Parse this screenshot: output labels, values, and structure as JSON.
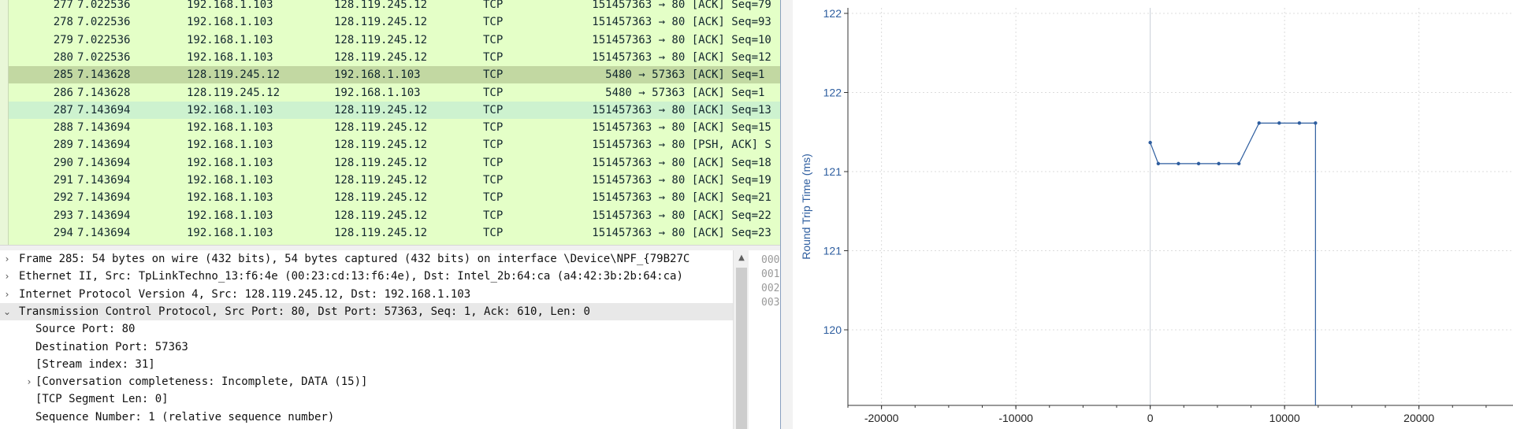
{
  "packet_list": {
    "rows": [
      {
        "no": "277",
        "time": "7.022536",
        "src": "192.168.1.103",
        "dst": "128.119.245.12",
        "proto": "TCP",
        "len": "1514",
        "info": "57363 → 80 [ACK] Seq=79",
        "state": "normal"
      },
      {
        "no": "278",
        "time": "7.022536",
        "src": "192.168.1.103",
        "dst": "128.119.245.12",
        "proto": "TCP",
        "len": "1514",
        "info": "57363 → 80 [ACK] Seq=93",
        "state": "normal"
      },
      {
        "no": "279",
        "time": "7.022536",
        "src": "192.168.1.103",
        "dst": "128.119.245.12",
        "proto": "TCP",
        "len": "1514",
        "info": "57363 → 80 [ACK] Seq=10",
        "state": "normal"
      },
      {
        "no": "280",
        "time": "7.022536",
        "src": "192.168.1.103",
        "dst": "128.119.245.12",
        "proto": "TCP",
        "len": "1514",
        "info": "57363 → 80 [ACK] Seq=12",
        "state": "normal"
      },
      {
        "no": "285",
        "time": "7.143628",
        "src": "128.119.245.12",
        "dst": "192.168.1.103",
        "proto": "TCP",
        "len": "54",
        "info": "80 → 57363 [ACK] Seq=1",
        "state": "selected"
      },
      {
        "no": "286",
        "time": "7.143628",
        "src": "128.119.245.12",
        "dst": "192.168.1.103",
        "proto": "TCP",
        "len": "54",
        "info": "80 → 57363 [ACK] Seq=1",
        "state": "normal"
      },
      {
        "no": "287",
        "time": "7.143694",
        "src": "192.168.1.103",
        "dst": "128.119.245.12",
        "proto": "TCP",
        "len": "1514",
        "info": "57363 → 80 [ACK] Seq=13",
        "state": "related"
      },
      {
        "no": "288",
        "time": "7.143694",
        "src": "192.168.1.103",
        "dst": "128.119.245.12",
        "proto": "TCP",
        "len": "1514",
        "info": "57363 → 80 [ACK] Seq=15",
        "state": "normal"
      },
      {
        "no": "289",
        "time": "7.143694",
        "src": "192.168.1.103",
        "dst": "128.119.245.12",
        "proto": "TCP",
        "len": "1514",
        "info": "57363 → 80 [PSH, ACK] S",
        "state": "normal"
      },
      {
        "no": "290",
        "time": "7.143694",
        "src": "192.168.1.103",
        "dst": "128.119.245.12",
        "proto": "TCP",
        "len": "1514",
        "info": "57363 → 80 [ACK] Seq=18",
        "state": "normal"
      },
      {
        "no": "291",
        "time": "7.143694",
        "src": "192.168.1.103",
        "dst": "128.119.245.12",
        "proto": "TCP",
        "len": "1514",
        "info": "57363 → 80 [ACK] Seq=19",
        "state": "normal"
      },
      {
        "no": "292",
        "time": "7.143694",
        "src": "192.168.1.103",
        "dst": "128.119.245.12",
        "proto": "TCP",
        "len": "1514",
        "info": "57363 → 80 [ACK] Seq=21",
        "state": "normal"
      },
      {
        "no": "293",
        "time": "7.143694",
        "src": "192.168.1.103",
        "dst": "128.119.245.12",
        "proto": "TCP",
        "len": "1514",
        "info": "57363 → 80 [ACK] Seq=22",
        "state": "normal"
      },
      {
        "no": "294",
        "time": "7.143694",
        "src": "192.168.1.103",
        "dst": "128.119.245.12",
        "proto": "TCP",
        "len": "1514",
        "info": "57363 → 80 [ACK] Seq=23",
        "state": "normal"
      }
    ]
  },
  "details": {
    "rows": [
      {
        "text": "Frame 285: 54 bytes on wire (432 bits), 54 bytes captured (432 bits) on interface \\Device\\NPF_{79B27C",
        "arrow": "›",
        "level": 0
      },
      {
        "text": "Ethernet II, Src: TpLinkTechno_13:f6:4e (00:23:cd:13:f6:4e), Dst: Intel_2b:64:ca (a4:42:3b:2b:64:ca)",
        "arrow": "›",
        "level": 0
      },
      {
        "text": "Internet Protocol Version 4, Src: 128.119.245.12, Dst: 192.168.1.103",
        "arrow": "›",
        "level": 0
      },
      {
        "text": "Transmission Control Protocol, Src Port: 80, Dst Port: 57363, Seq: 1, Ack: 610, Len: 0",
        "arrow": "⌄",
        "level": 0,
        "active": true
      },
      {
        "text": "Source Port: 80",
        "arrow": "",
        "level": 1
      },
      {
        "text": "Destination Port: 57363",
        "arrow": "",
        "level": 1
      },
      {
        "text": "[Stream index: 31]",
        "arrow": "",
        "level": 1
      },
      {
        "text": "[Conversation completeness: Incomplete, DATA (15)]",
        "arrow": "›",
        "level": 1
      },
      {
        "text": "[TCP Segment Len: 0]",
        "arrow": "",
        "level": 1
      },
      {
        "text": "Sequence Number: 1    (relative sequence number)",
        "arrow": "",
        "level": 1
      }
    ]
  },
  "bytes_pane": {
    "offsets": [
      "000",
      "001",
      "002",
      "003"
    ]
  },
  "chart_data": {
    "type": "line",
    "title": "",
    "xlabel": "",
    "ylabel": "Round Trip Time (ms)",
    "x_ticks": [
      "-20000",
      "-10000",
      "0",
      "10000",
      "20000"
    ],
    "y_ticks": [
      "120",
      "121",
      "121",
      "122",
      "122"
    ],
    "xlim": [
      -22500,
      27000
    ],
    "ylim": [
      119.6,
      122.05
    ],
    "grid": true,
    "color": "#2d5d9f",
    "series": [
      {
        "x": [
          0,
          600,
          2100,
          3600,
          5100,
          6600,
          8100,
          9600,
          11100,
          12300,
          12300
        ],
        "y": [
          121.22,
          121.09,
          121.09,
          121.09,
          121.09,
          121.09,
          121.34,
          121.34,
          121.34,
          121.34,
          119.6
        ]
      }
    ]
  }
}
